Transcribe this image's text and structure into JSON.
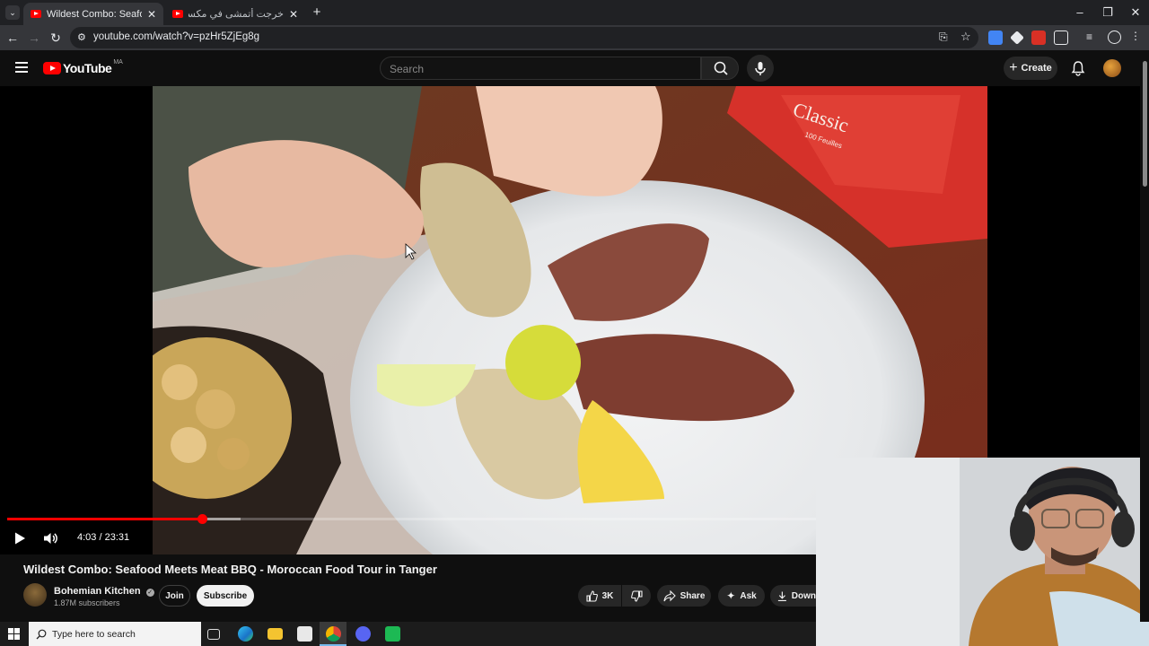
{
  "browser": {
    "tabs": [
      {
        "title": "Wildest Combo: Seafood M",
        "active": true
      },
      {
        "title": "خرجت أتمشى في مكسيكو... وتعرّ",
        "active": false
      }
    ],
    "url": "youtube.com/watch?v=pzHr5ZjEg8g"
  },
  "youtube": {
    "logo_text": "YouTube",
    "region": "MA",
    "search_placeholder": "Search",
    "create_label": "Create"
  },
  "player": {
    "current_time": "4:03",
    "duration": "23:31",
    "time_display": "4:03 / 23:31",
    "progress_fraction": 0.172,
    "buffered_fraction": 0.206,
    "video_text": {
      "napkin_brand": "Classic",
      "napkin_sub": "100 Feuilles"
    }
  },
  "video": {
    "title": "Wildest Combo: Seafood Meets Meat BBQ - Moroccan Food Tour in Tanger",
    "channel_name": "Bohemian Kitchen",
    "subscribers": "1.87M subscribers",
    "join_label": "Join",
    "subscribe_label": "Subscribe",
    "like_count": "3K",
    "share_label": "Share",
    "ask_label": "Ask",
    "download_label": "Down"
  },
  "taskbar": {
    "search_placeholder": "Type here to search"
  },
  "colors": {
    "youtube_red": "#ff0000",
    "page_bg": "#0f0f0f",
    "chrome_tab": "#35363a"
  },
  "icons": [
    "tab-list-icon",
    "youtube-favicon",
    "close-icon",
    "new-tab-icon",
    "minimize-icon",
    "restore-icon",
    "back-icon",
    "forward-icon",
    "reload-icon",
    "site-info-icon",
    "install-icon",
    "bookmark-star-icon",
    "translate-icon",
    "extension-icon",
    "puzzle-icon",
    "media-icon",
    "profile-icon",
    "menu-icon",
    "hamburger-icon",
    "search-icon",
    "mic-icon",
    "plus-icon",
    "bell-icon",
    "play-icon",
    "volume-icon",
    "verified-icon",
    "thumbs-up-icon",
    "thumbs-down-icon",
    "share-icon",
    "sparkle-icon",
    "download-icon",
    "windows-icon",
    "task-view-icon",
    "edge-icon",
    "file-explorer-icon",
    "store-icon",
    "chrome-icon"
  ]
}
